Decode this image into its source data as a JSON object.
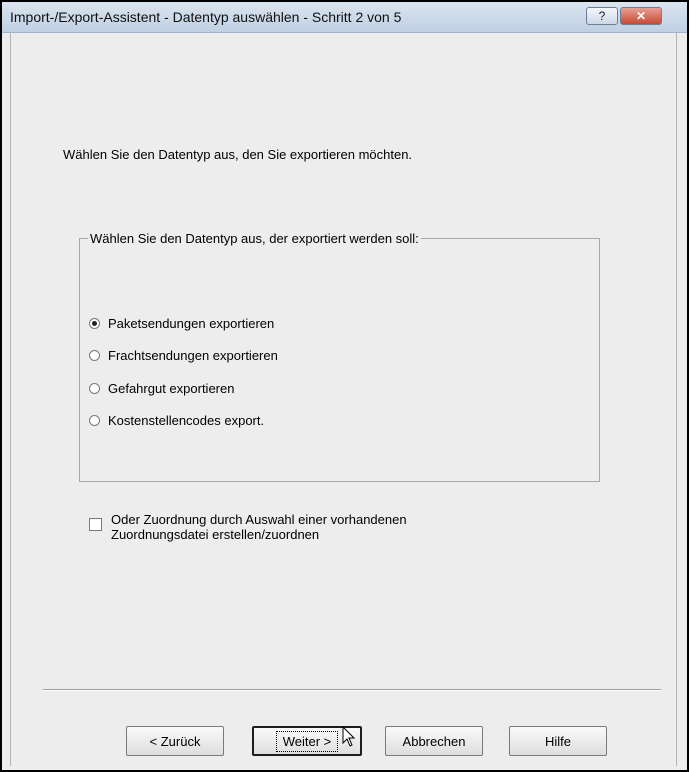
{
  "window": {
    "title": "Import-/Export-Assistent - Datentyp auswählen - Schritt 2 von 5",
    "help_button": "?",
    "close_button": "✕"
  },
  "intro_text": "Wählen Sie den Datentyp aus, den Sie exportieren möchten.",
  "group": {
    "legend": "Wählen Sie den Datentyp aus, der exportiert werden soll:",
    "options": [
      {
        "label": "Paketsendungen exportieren",
        "selected": true
      },
      {
        "label": "Frachtsendungen exportieren",
        "selected": false
      },
      {
        "label": "Gefahrgut exportieren",
        "selected": false
      },
      {
        "label": "Kostenstellencodes export.",
        "selected": false
      }
    ]
  },
  "mapping_checkbox": {
    "checked": false,
    "line1": "Oder Zuordnung durch Auswahl einer vorhandenen",
    "line2": "Zuordnungsdatei erstellen/zuordnen"
  },
  "buttons": {
    "back": "< Zurück",
    "next": "Weiter >",
    "cancel": "Abbrechen",
    "help": "Hilfe"
  }
}
